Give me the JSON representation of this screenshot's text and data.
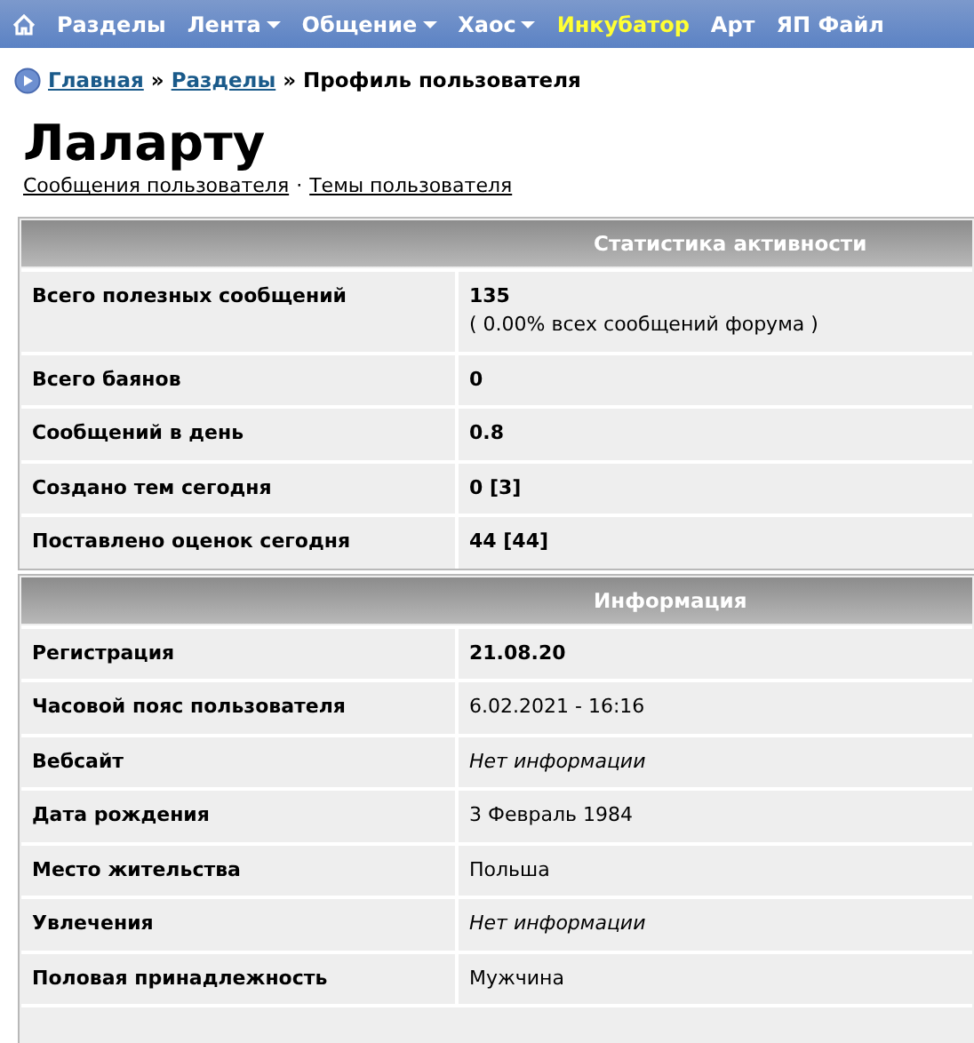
{
  "nav": [
    {
      "label": "Разделы",
      "dropdown": false,
      "highlighted": false
    },
    {
      "label": "Лента",
      "dropdown": true,
      "highlighted": false
    },
    {
      "label": "Общение",
      "dropdown": true,
      "highlighted": false
    },
    {
      "label": "Хаос",
      "dropdown": true,
      "highlighted": false
    },
    {
      "label": "Инкубатор",
      "dropdown": false,
      "highlighted": true
    },
    {
      "label": "Арт",
      "dropdown": false,
      "highlighted": false
    },
    {
      "label": "ЯП Файл",
      "dropdown": false,
      "highlighted": false
    }
  ],
  "breadcrumb": {
    "links": [
      "Главная",
      "Разделы"
    ],
    "separator": "»",
    "current": "Профиль пользователя"
  },
  "profile": {
    "name": "Лаларту",
    "links": [
      "Сообщения пользователя",
      "Темы пользователя"
    ],
    "link_separator": "·"
  },
  "sections": [
    {
      "title": "Статистика активности",
      "rows": [
        {
          "label": "Всего полезных сообщений",
          "value": "135",
          "kind": "highlighted",
          "note": "( 0.00% всех сообщений форума )"
        },
        {
          "label": "Всего баянов",
          "value": "0",
          "kind": "highlighted"
        },
        {
          "label": "Сообщений в день",
          "value": "0.8",
          "kind": "highlighted"
        },
        {
          "label": "Создано тем сегодня",
          "value": "0 [3]",
          "kind": "highlighted"
        },
        {
          "label": "Поставлено оценок сегодня",
          "value": "44 [44]",
          "kind": "highlighted"
        }
      ]
    },
    {
      "title": "Информация",
      "rows": [
        {
          "label": "Регистрация",
          "value": "21.08.20",
          "kind": "highlighted"
        },
        {
          "label": "Часовой пояс пользователя",
          "value": "6.02.2021 - 16:16",
          "kind": "plain"
        },
        {
          "label": "Вебсайт",
          "value": "Нет информации",
          "kind": "missing"
        },
        {
          "label": "Дата рождения",
          "value": "3 Февраль 1984",
          "kind": "plain"
        },
        {
          "label": "Место жительства",
          "value": "Польша",
          "kind": "plain"
        },
        {
          "label": "Увлечения",
          "value": "Нет информации",
          "kind": "missing"
        },
        {
          "label": "Половая принадлежность",
          "value": "Мужчина",
          "kind": "plain"
        }
      ]
    }
  ]
}
